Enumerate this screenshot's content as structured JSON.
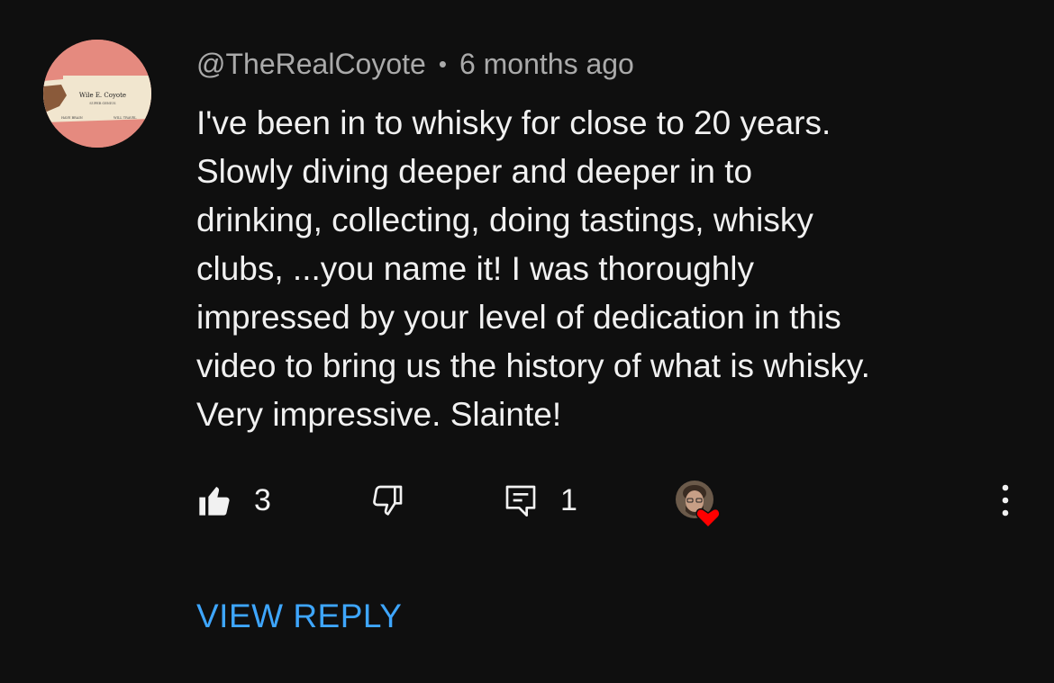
{
  "comment": {
    "author": "@TheRealCoyote",
    "separator": "•",
    "timestamp": "6 months ago",
    "text": "I've been in to whisky for close to 20 years.\nSlowly diving deeper and deeper in to\ndrinking, collecting, doing tastings, whisky\nclubs, ...you name it! I was thoroughly\nimpressed by your level of dedication in this\nvideo to bring us the history of what is whisky.\nVery impressive. Slainte!",
    "avatar": {
      "card_name": "Wile E. Coyote",
      "card_title": "SUPER GENIUS",
      "card_left": "HAVE BRAIN",
      "card_right": "WILL TRAVEL"
    }
  },
  "actions": {
    "like_icon": "thumbs-up-filled-icon",
    "like_count": "3",
    "dislike_icon": "thumbs-down-outline-icon",
    "reply_icon": "comment-icon",
    "reply_count": "1",
    "hearted_icon": "creator-heart-icon",
    "more_icon": "more-vertical-icon"
  },
  "view_reply_label": "VIEW REPLY",
  "colors": {
    "background": "#0f0f0f",
    "text": "#f1f1f1",
    "meta": "#aaaaaa",
    "link": "#3ea6ff",
    "heart": "#ff0000"
  }
}
